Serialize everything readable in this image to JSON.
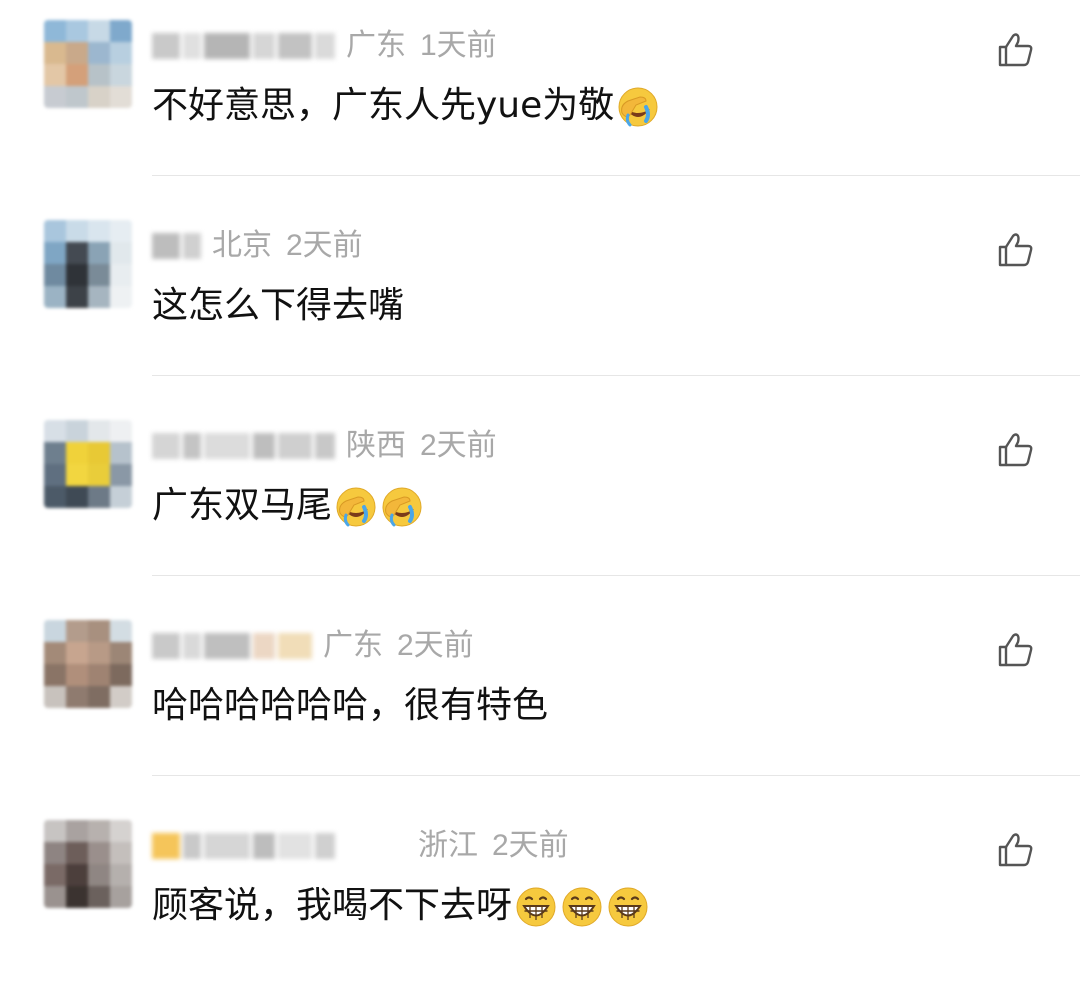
{
  "comments": [
    {
      "location": "广东",
      "time": "1天前",
      "text": "不好意思，广东人先yue为敬",
      "emojis": [
        "facepalm-crying-emoji"
      ],
      "avatar_colors": [
        "#8fb8d8",
        "#a9c8e0",
        "#c7d9e6",
        "#7fa9cc",
        "#d9b98f",
        "#c9a98a",
        "#9cb7cf",
        "#b8cfe0",
        "#e3c7a6",
        "#d4a07a",
        "#b7c2c8",
        "#c9d6de",
        "#c7cbd1",
        "#bfc7cc",
        "#d8d2c8",
        "#e2ddd6"
      ],
      "nick_colors": [
        "#c9c9c9",
        "#e0e0e0",
        "#b5b5b5",
        "#d6d6d6",
        "#c2c2c2",
        "#dadada"
      ]
    },
    {
      "location": "北京",
      "time": "2天前",
      "text": "这怎么下得去嘴",
      "emojis": [],
      "avatar_colors": [
        "#a9c6dd",
        "#c9dbe8",
        "#d9e5ee",
        "#e6edf2",
        "#7fa6c4",
        "#444a52",
        "#8aa3b5",
        "#e1e8ec",
        "#6f8aa0",
        "#2f3338",
        "#7a8b98",
        "#e8edf0",
        "#9bb3c4",
        "#3d4248",
        "#a6b5c0",
        "#eef1f3"
      ],
      "nick_colors": [
        "#bdbdbd",
        "#d0d0d0"
      ]
    },
    {
      "location": "陕西",
      "time": "2天前",
      "text": "广东双马尾",
      "emojis": [
        "facepalm-crying-emoji",
        "facepalm-crying-emoji"
      ],
      "avatar_colors": [
        "#d7dfe6",
        "#c9d3db",
        "#e3e7ea",
        "#eef0f2",
        "#6e7f8e",
        "#f0d23a",
        "#e8c935",
        "#b6c2cc",
        "#5f6f80",
        "#f2d640",
        "#e9cd3a",
        "#8a98a6",
        "#4c5a68",
        "#3f4a55",
        "#6d7a87",
        "#c5cfd7"
      ],
      "nick_colors": [
        "#d5d5d5",
        "#c4c4c4",
        "#dcdcdc",
        "#bebebe",
        "#cfcfcf",
        "#c8c8c8"
      ]
    },
    {
      "location": "广东",
      "time": "2天前",
      "text": "哈哈哈哈哈哈，很有特色",
      "emojis": [],
      "avatar_colors": [
        "#c9d6df",
        "#b39c8c",
        "#a8907f",
        "#d3dde3",
        "#a38a78",
        "#c7a58f",
        "#b89a86",
        "#9c8676",
        "#8a7466",
        "#b08f7b",
        "#9f8372",
        "#7d6a5e",
        "#c8c2bd",
        "#8f7b6f",
        "#7f6d62",
        "#d2ccc7"
      ],
      "nick_colors": [
        "#c9c9c9",
        "#d9d9d9",
        "#bfbfbf",
        "#ecd7c4",
        "#f1ddb8"
      ]
    },
    {
      "location": "浙江",
      "time": "2天前",
      "text": "顾客说，我喝不下去呀",
      "emojis": [
        "grinning-emoji",
        "grinning-emoji",
        "grinning-emoji"
      ],
      "avatar_colors": [
        "#c7c4c2",
        "#a9a2a0",
        "#b7b1ae",
        "#d5d2d0",
        "#8e8482",
        "#6d5e5a",
        "#9a8f8c",
        "#c4bfbc",
        "#7a6a66",
        "#4c3f3c",
        "#8f8683",
        "#b5b0ad",
        "#9a928f",
        "#3b3330",
        "#6b615d",
        "#a7a19e"
      ],
      "nick_colors": [
        "#f5c55a",
        "#c9c9c9",
        "#d6d6d6",
        "#bdbdbd",
        "#e2e2e2",
        "#d0d0d0"
      ]
    }
  ],
  "colors": {
    "meta_text": "#a8a8a8",
    "body_text": "#111111",
    "divider": "#e6e6e6",
    "like_icon": "#555555"
  }
}
